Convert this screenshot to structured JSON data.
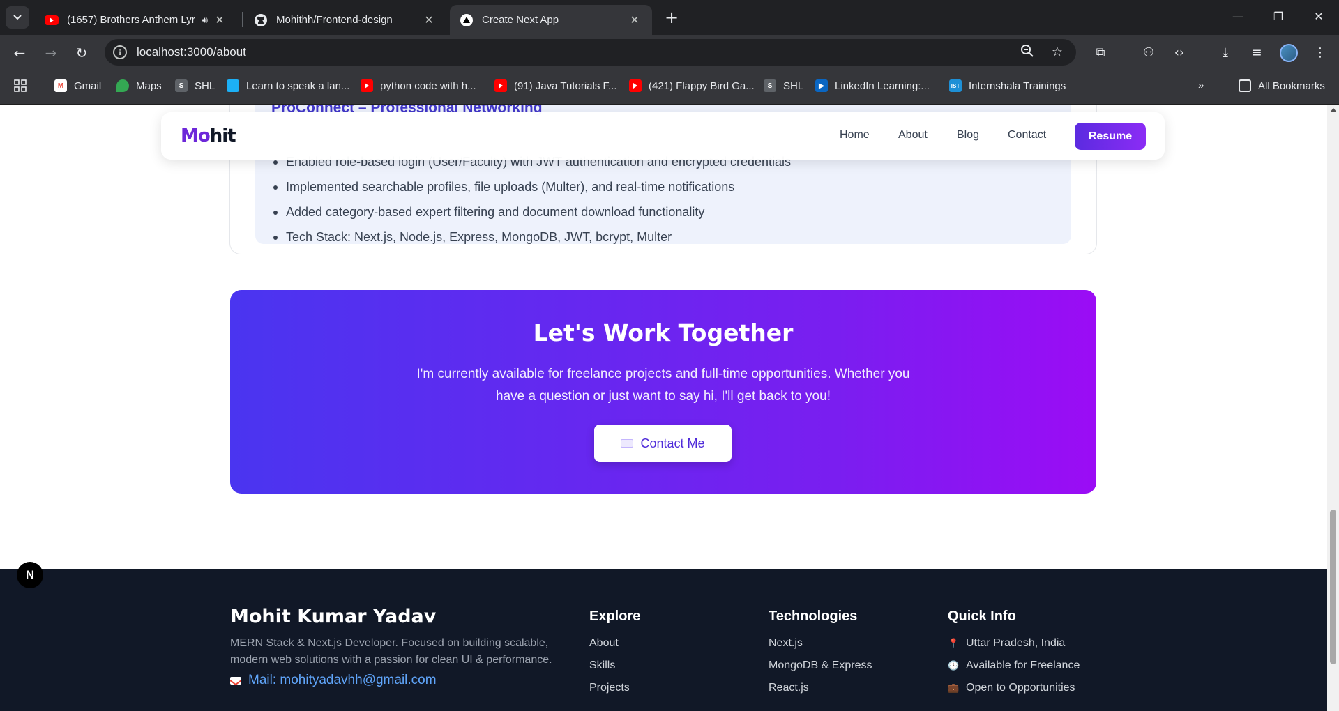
{
  "browser": {
    "tabs": [
      {
        "title": "(1657) Brothers Anthem Lyr",
        "icon": "youtube-icon"
      },
      {
        "title": "Mohithh/Frontend-design",
        "icon": "github-icon"
      },
      {
        "title": "Create Next App",
        "icon": "nextjs-icon",
        "active": true
      }
    ],
    "url": "localhost:3000/about",
    "bookmarks": [
      {
        "label": "Gmail",
        "icon": "gmail-icon"
      },
      {
        "label": "Maps",
        "icon": "maps-icon"
      },
      {
        "label": "SHL",
        "icon": "shl-icon"
      },
      {
        "label": "Learn to speak a lan...",
        "icon": "duolingo-icon"
      },
      {
        "label": "python code with h...",
        "icon": "youtube-icon"
      },
      {
        "label": "(91) Java Tutorials F...",
        "icon": "youtube-icon"
      },
      {
        "label": "(421) Flappy Bird Ga...",
        "icon": "youtube-icon"
      },
      {
        "label": "SHL",
        "icon": "shl-icon"
      },
      {
        "label": "LinkedIn Learning:...",
        "icon": "linkedin-learning-icon"
      },
      {
        "label": "Internshala Trainings",
        "icon": "internshala-icon"
      }
    ],
    "all_bookmarks": "All Bookmarks"
  },
  "project": {
    "title": "ProConnect – Professional Networking",
    "bullets": [
      "Enabled role-based login (User/Faculty) with JWT authentication and encrypted credentials",
      "Implemented searchable profiles, file uploads (Multer), and real-time notifications",
      "Added category-based expert filtering and document download functionality",
      "Tech Stack: Next.js, Node.js, Express, MongoDB, JWT, bcrypt, Multer"
    ]
  },
  "nav": {
    "logo_a": "Mo",
    "logo_b": "hit",
    "links": [
      "Home",
      "About",
      "Blog",
      "Contact"
    ],
    "resume": "Resume"
  },
  "cta": {
    "title": "Let's Work Together",
    "text": "I'm currently available for freelance projects and full-time opportunities. Whether you have a question or just want to say hi, I'll get back to you!",
    "button": "Contact Me"
  },
  "footer": {
    "name": "Mohit Kumar Yadav",
    "description": "MERN Stack & Next.js Developer. Focused on building scalable, modern web solutions with a passion for clean UI & performance.",
    "mail": "Mail: mohityadavhh@gmail.com",
    "explore_title": "Explore",
    "explore": [
      "About",
      "Skills",
      "Projects"
    ],
    "tech_title": "Technologies",
    "tech": [
      "Next.js",
      "MongoDB & Express",
      "React.js"
    ],
    "quick_title": "Quick Info",
    "quick": [
      {
        "icon": "📍",
        "text": "Uttar Pradesh, India"
      },
      {
        "icon": "🕓",
        "text": "Available for Freelance"
      },
      {
        "icon": "💼",
        "text": "Open to Opportunities"
      }
    ]
  },
  "next_badge": "N"
}
